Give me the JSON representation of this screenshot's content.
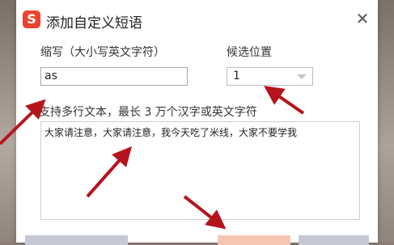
{
  "dialog": {
    "title": "添加自定义短语",
    "logo_letter": "S",
    "close_glyph": "✕"
  },
  "abbrev": {
    "label": "缩写（大小写英文字符）",
    "value": "as"
  },
  "position": {
    "label": "候选位置",
    "value": "1"
  },
  "content": {
    "label": "支持多行文本，最长 3 万个汉字或英文字符",
    "value": "大家请注意，大家请注意，我今天吃了米线，大家不要学我"
  },
  "colors": {
    "accent": "#e8452c",
    "arrow": "#b5141c",
    "button_primary": "#f7c6b2",
    "button_secondary": "#c6c8d3"
  },
  "icons": [
    "sogou-logo-icon",
    "close-icon",
    "chevron-down-icon",
    "annotation-arrow"
  ]
}
